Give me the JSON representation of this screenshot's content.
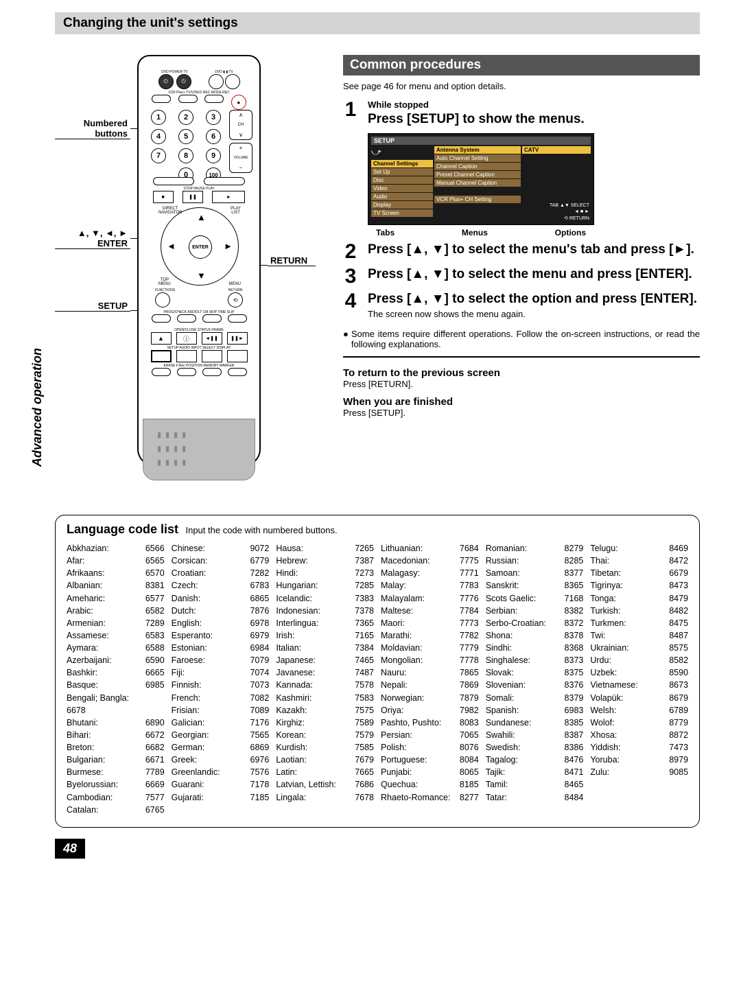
{
  "header": "Changing the unit's settings",
  "sidebar": "Advanced operation",
  "callouts": {
    "numbered": "Numbered buttons",
    "arrows": "▲, ▼, ◄, ►\nENTER",
    "setup": "SETUP",
    "return": "RETURN"
  },
  "remote": {
    "top_labels": [
      "DVD",
      "POWER",
      "TV",
      "DVD",
      "TV"
    ],
    "row2_label": "VCR Plus+ TV/VIDEO REC MODE  REC",
    "vol_ch": "CH  VOLUME",
    "seek": "◄◄ ►►",
    "transport_labels": "STOP  PAUSE  PLAY",
    "nav_corners": [
      "DIRECT NAVIGATOR",
      "PLAY LIST",
      "TOP MENU",
      "MENU"
    ],
    "enter": "ENTER",
    "below_nav": [
      "FUNCTIONS",
      "RETURN"
    ],
    "small_row": "PROG/CHECK  ADD/DLT  CM SKIP  TIME SLIP",
    "small_row2": "OPEN/CLOSE  STATUS  FRAME",
    "setup_row": "SETUP  AUDIO  INPUT SELECT  DISPLAY",
    "erase_row": "ERASE  F.Rec  POSITION MEMORY  MARKER"
  },
  "section_title": "Common procedures",
  "seepage": "See page 46 for menu and option details.",
  "steps": [
    {
      "n": "1",
      "small": "While stopped",
      "title": "Press [SETUP] to show the menus."
    },
    {
      "n": "2",
      "title": "Press [▲, ▼] to select the menu's tab and press [►]."
    },
    {
      "n": "3",
      "title": "Press [▲, ▼] to select the menu and press [ENTER]."
    },
    {
      "n": "4",
      "title": "Press [▲, ▼] to select the option and press [ENTER].",
      "note": "The screen now shows the menu again."
    }
  ],
  "bullet_note": "Some items require different operations. Follow the on-screen instructions, or read the following explanations.",
  "return_h": "To return to the previous screen",
  "return_p": "Press [RETURN].",
  "finish_h": "When you are finished",
  "finish_p": "Press [SETUP].",
  "osd": {
    "title": "SETUP",
    "tabs": [
      "Channel Settings",
      "Set Up",
      "Disc",
      "Video",
      "Audio",
      "Display",
      "TV Screen"
    ],
    "menus": [
      "Antenna System",
      "Auto Channel Setting",
      "Channel Caption",
      "Preset Channel Caption",
      "Manual Channel Caption",
      "",
      "VCR Plus+ CH Setting"
    ],
    "opt": "CATV",
    "foot1": "TAB ▲▼  SELECT",
    "foot2": "◄ ■ ►",
    "foot3": "⟲ RETURN",
    "legend": [
      "Tabs",
      "Menus",
      "Options"
    ]
  },
  "langlist": {
    "title": "Language code list",
    "sub": "Input the code with numbered buttons.",
    "columns": [
      [
        [
          "Abkhazian:",
          "6566"
        ],
        [
          "Afar:",
          "6565"
        ],
        [
          "Afrikaans:",
          "6570"
        ],
        [
          "Albanian:",
          "8381"
        ],
        [
          "Ameharic:",
          "6577"
        ],
        [
          "Arabic:",
          "6582"
        ],
        [
          "Armenian:",
          "7289"
        ],
        [
          "Assamese:",
          "6583"
        ],
        [
          "Aymara:",
          "6588"
        ],
        [
          "Azerbaijani:",
          "6590"
        ],
        [
          "Bashkir:",
          "6665"
        ],
        [
          "Basque:",
          "6985"
        ],
        [
          "Bengali; Bangla:",
          ""
        ],
        [
          "6678",
          ""
        ],
        [
          "Bhutani:",
          "6890"
        ],
        [
          "Bihari:",
          "6672"
        ],
        [
          "Breton:",
          "6682"
        ],
        [
          "Bulgarian:",
          "6671"
        ],
        [
          "Burmese:",
          "7789"
        ],
        [
          "Byelorussian:",
          "6669"
        ],
        [
          "Cambodian:",
          "7577"
        ],
        [
          "Catalan:",
          "6765"
        ]
      ],
      [
        [
          "Chinese:",
          "9072"
        ],
        [
          "Corsican:",
          "6779"
        ],
        [
          "Croatian:",
          "7282"
        ],
        [
          "Czech:",
          "6783"
        ],
        [
          "Danish:",
          "6865"
        ],
        [
          "Dutch:",
          "7876"
        ],
        [
          "English:",
          "6978"
        ],
        [
          "Esperanto:",
          "6979"
        ],
        [
          "Estonian:",
          "6984"
        ],
        [
          "Faroese:",
          "7079"
        ],
        [
          "Fiji:",
          "7074"
        ],
        [
          "Finnish:",
          "7073"
        ],
        [
          "French:",
          "7082"
        ],
        [
          "Frisian:",
          "7089"
        ],
        [
          "Galician:",
          "7176"
        ],
        [
          "Georgian:",
          "7565"
        ],
        [
          "German:",
          "6869"
        ],
        [
          "Greek:",
          "6976"
        ],
        [
          "Greenlandic:",
          "7576"
        ],
        [
          "Guarani:",
          "7178"
        ],
        [
          "Gujarati:",
          "7185"
        ]
      ],
      [
        [
          "Hausa:",
          "7265"
        ],
        [
          "Hebrew:",
          "7387"
        ],
        [
          "Hindi:",
          "7273"
        ],
        [
          "Hungarian:",
          "7285"
        ],
        [
          "Icelandic:",
          "7383"
        ],
        [
          "Indonesian:",
          "7378"
        ],
        [
          "Interlingua:",
          "7365"
        ],
        [
          "Irish:",
          "7165"
        ],
        [
          "Italian:",
          "7384"
        ],
        [
          "Japanese:",
          "7465"
        ],
        [
          "Javanese:",
          "7487"
        ],
        [
          "Kannada:",
          "7578"
        ],
        [
          "Kashmiri:",
          "7583"
        ],
        [
          "Kazakh:",
          "7575"
        ],
        [
          "Kirghiz:",
          "7589"
        ],
        [
          "Korean:",
          "7579"
        ],
        [
          "Kurdish:",
          "7585"
        ],
        [
          "Laotian:",
          "7679"
        ],
        [
          "Latin:",
          "7665"
        ],
        [
          "Latvian, Lettish:",
          "7686"
        ],
        [
          "Lingala:",
          "7678"
        ]
      ],
      [
        [
          "Lithuanian:",
          "7684"
        ],
        [
          "Macedonian:",
          "7775"
        ],
        [
          "Malagasy:",
          "7771"
        ],
        [
          "Malay:",
          "7783"
        ],
        [
          "Malayalam:",
          "7776"
        ],
        [
          "Maltese:",
          "7784"
        ],
        [
          "Maori:",
          "7773"
        ],
        [
          "Marathi:",
          "7782"
        ],
        [
          "Moldavian:",
          "7779"
        ],
        [
          "Mongolian:",
          "7778"
        ],
        [
          "Nauru:",
          "7865"
        ],
        [
          "Nepali:",
          "7869"
        ],
        [
          "Norwegian:",
          "7879"
        ],
        [
          "Oriya:",
          "7982"
        ],
        [
          "Pashto, Pushto:",
          "8083"
        ],
        [
          "Persian:",
          "7065"
        ],
        [
          "Polish:",
          "8076"
        ],
        [
          "Portuguese:",
          "8084"
        ],
        [
          "Punjabi:",
          "8065"
        ],
        [
          "Quechua:",
          "8185"
        ],
        [
          "Rhaeto-Romance:",
          "8277"
        ]
      ],
      [
        [
          "Romanian:",
          "8279"
        ],
        [
          "Russian:",
          "8285"
        ],
        [
          "Samoan:",
          "8377"
        ],
        [
          "Sanskrit:",
          "8365"
        ],
        [
          "Scots Gaelic:",
          "7168"
        ],
        [
          "Serbian:",
          "8382"
        ],
        [
          "Serbo-Croatian:",
          "8372"
        ],
        [
          "Shona:",
          "8378"
        ],
        [
          "Sindhi:",
          "8368"
        ],
        [
          "Singhalese:",
          "8373"
        ],
        [
          "Slovak:",
          "8375"
        ],
        [
          "Slovenian:",
          "8376"
        ],
        [
          "Somali:",
          "8379"
        ],
        [
          "Spanish:",
          "6983"
        ],
        [
          "Sundanese:",
          "8385"
        ],
        [
          "Swahili:",
          "8387"
        ],
        [
          "Swedish:",
          "8386"
        ],
        [
          "Tagalog:",
          "8476"
        ],
        [
          "Tajik:",
          "8471"
        ],
        [
          "Tamil:",
          "8465"
        ],
        [
          "Tatar:",
          "8484"
        ]
      ],
      [
        [
          "Telugu:",
          "8469"
        ],
        [
          "Thai:",
          "8472"
        ],
        [
          "Tibetan:",
          "6679"
        ],
        [
          "Tigrinya:",
          "8473"
        ],
        [
          "Tonga:",
          "8479"
        ],
        [
          "Turkish:",
          "8482"
        ],
        [
          "Turkmen:",
          "8475"
        ],
        [
          "Twi:",
          "8487"
        ],
        [
          "Ukrainian:",
          "8575"
        ],
        [
          "Urdu:",
          "8582"
        ],
        [
          "Uzbek:",
          "8590"
        ],
        [
          "Vietnamese:",
          "8673"
        ],
        [
          "Volapük:",
          "8679"
        ],
        [
          "Welsh:",
          "6789"
        ],
        [
          "Wolof:",
          "8779"
        ],
        [
          "Xhosa:",
          "8872"
        ],
        [
          "Yiddish:",
          "7473"
        ],
        [
          "Yoruba:",
          "8979"
        ],
        [
          "Zulu:",
          "9085"
        ]
      ]
    ]
  },
  "page_num": "48"
}
